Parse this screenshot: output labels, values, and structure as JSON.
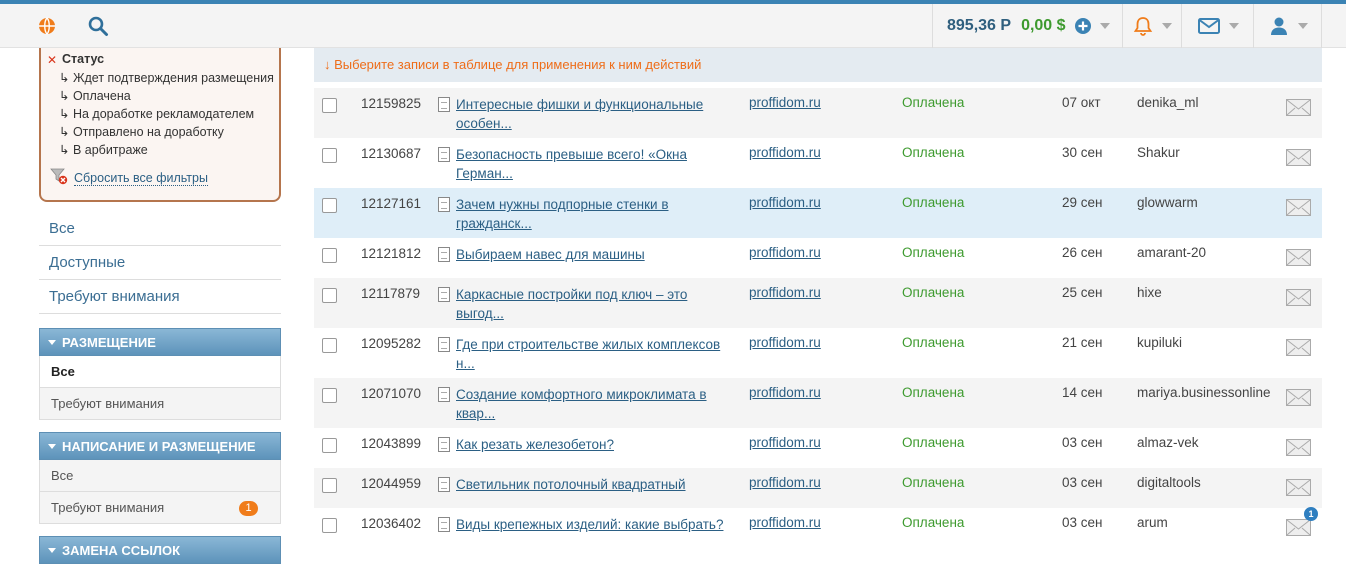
{
  "header": {
    "balance_rub": "895,36 Р",
    "balance_usd": "0,00 $"
  },
  "filters": {
    "group_title": "Статус",
    "items": [
      "Ждет подтверждения размещения",
      "Оплачена",
      "На доработке рекламодателем",
      "Отправлено на доработку",
      "В арбитраже"
    ],
    "reset_label": "Сбросить все фильтры"
  },
  "sidebar": {
    "links": [
      "Все",
      "Доступные",
      "Требуют внимания"
    ],
    "sections": [
      {
        "title": "РАЗМЕЩЕНИЕ",
        "items": [
          {
            "label": "Все"
          },
          {
            "label": "Требуют внимания"
          }
        ]
      },
      {
        "title": "НАПИСАНИЕ И РАЗМЕЩЕНИЕ",
        "items": [
          {
            "label": "Все"
          },
          {
            "label": "Требуют внимания",
            "badge": "1"
          }
        ]
      },
      {
        "title": "ЗАМЕНА ССЫЛОК"
      }
    ]
  },
  "notice": {
    "text": "Выберите записи в таблице для применения к ним действий",
    "arrow": "↓"
  },
  "rows": [
    {
      "id": "12159825",
      "title": "Интересные фишки и функциональные особен...",
      "site": "proffidom.ru",
      "status": "Оплачена",
      "date": "07 окт",
      "user": "denika_ml"
    },
    {
      "id": "12130687",
      "title": "Безопасность превыше всего! «Окна Герман...",
      "site": "proffidom.ru",
      "status": "Оплачена",
      "date": "30 сен",
      "user": "Shakur"
    },
    {
      "id": "12127161",
      "title": "Зачем нужны подпорные стенки в гражданск...",
      "site": "proffidom.ru",
      "status": "Оплачена",
      "date": "29 сен",
      "user": "glowwarm"
    },
    {
      "id": "12121812",
      "title": "Выбираем навес для машины",
      "site": "proffidom.ru",
      "status": "Оплачена",
      "date": "26 сен",
      "user": "amarant-20"
    },
    {
      "id": "12117879",
      "title": "Каркасные постройки под ключ – это выгод...",
      "site": "proffidom.ru",
      "status": "Оплачена",
      "date": "25 сен",
      "user": "hixe"
    },
    {
      "id": "12095282",
      "title": "Где при строительстве жилых комплексов н...",
      "site": "proffidom.ru",
      "status": "Оплачена",
      "date": "21 сен",
      "user": "kupiluki"
    },
    {
      "id": "12071070",
      "title": "Создание комфортного микроклимата в квар...",
      "site": "proffidom.ru",
      "status": "Оплачена",
      "date": "14 сен",
      "user": "mariya.businessonline"
    },
    {
      "id": "12043899",
      "title": "Как резать железобетон?",
      "site": "proffidom.ru",
      "status": "Оплачена",
      "date": "03 сен",
      "user": "almaz-vek"
    },
    {
      "id": "12044959",
      "title": "Светильник потолочный квадратный",
      "site": "proffidom.ru",
      "status": "Оплачена",
      "date": "03 сен",
      "user": "digitaltools"
    },
    {
      "id": "12036402",
      "title": "Виды крепежных изделий: какие выбрать?",
      "site": "proffidom.ru",
      "status": "Оплачена",
      "date": "03 сен",
      "user": "arum",
      "mail_badge": "1"
    }
  ]
}
